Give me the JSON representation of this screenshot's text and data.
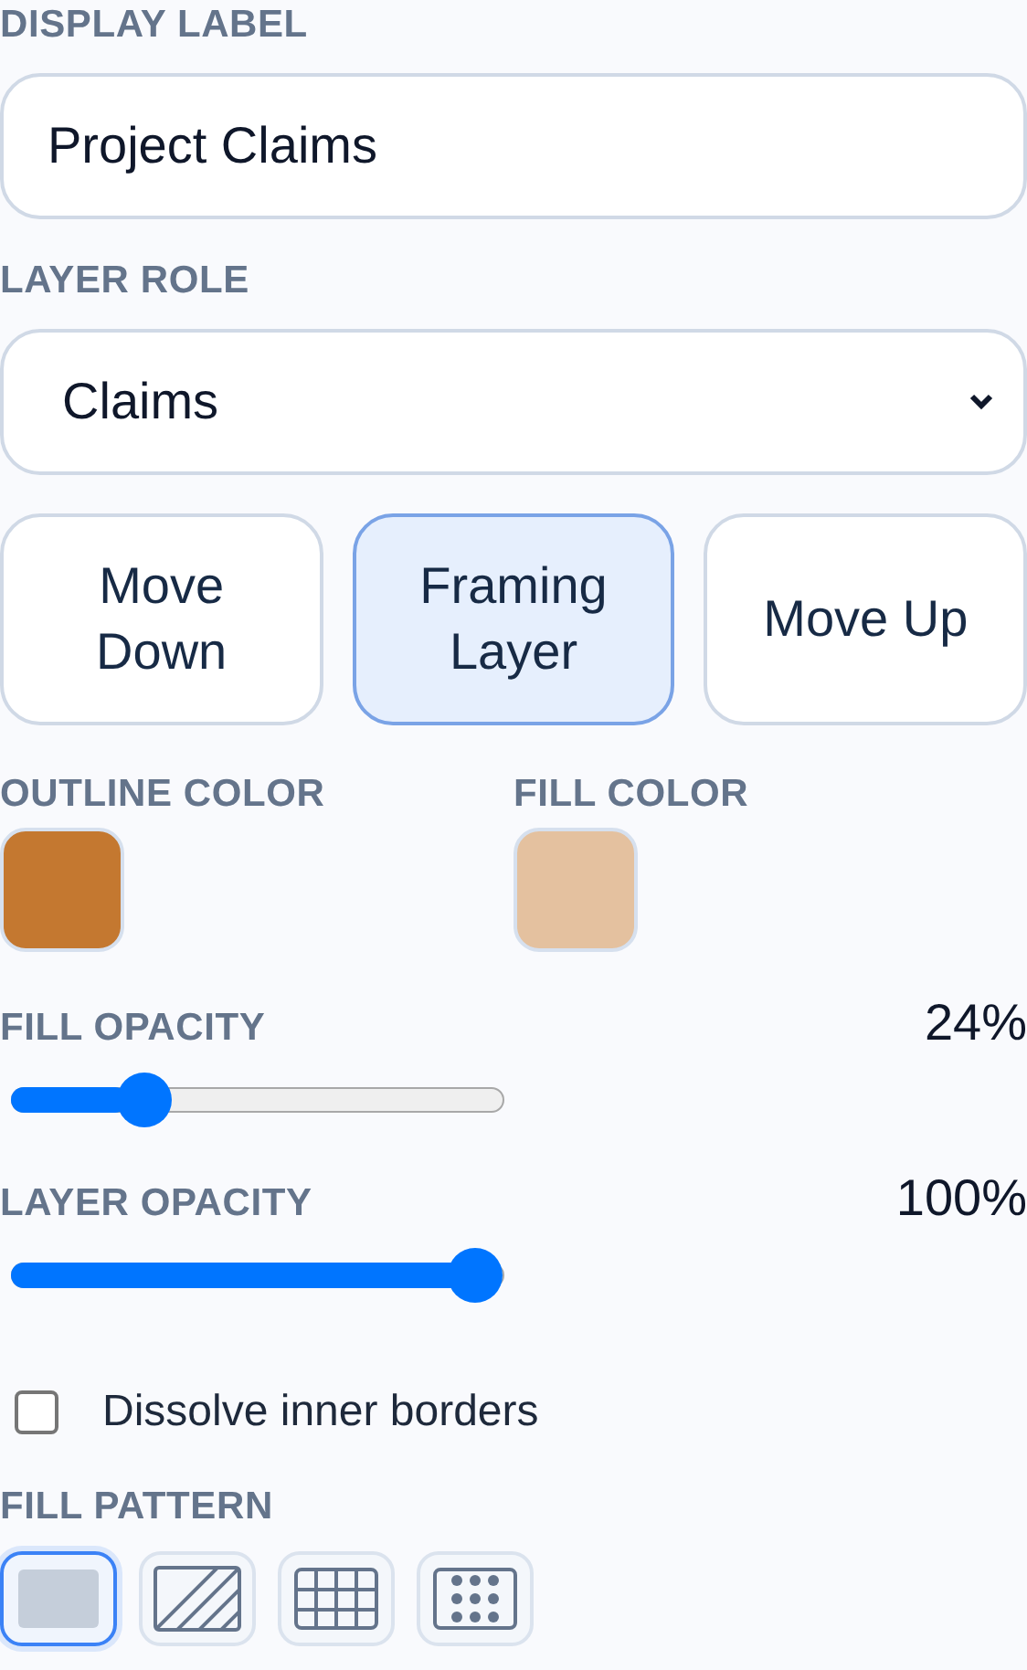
{
  "display_label": {
    "label": "DISPLAY LABEL",
    "value": "Project Claims"
  },
  "layer_role": {
    "label": "LAYER ROLE",
    "value": "Claims"
  },
  "order_buttons": [
    {
      "label": "Move Down",
      "selected": false
    },
    {
      "label": "Framing Layer",
      "selected": true
    },
    {
      "label": "Move Up",
      "selected": false
    }
  ],
  "colors": [
    {
      "label": "OUTLINE COLOR",
      "color": "#c47830"
    },
    {
      "label": "FILL COLOR",
      "color": "#e4c19f"
    }
  ],
  "sliders": [
    {
      "label": "FILL OPACITY",
      "reading": "24%",
      "level": 0.24
    },
    {
      "label": "LAYER OPACITY",
      "reading": "100%",
      "level": 1
    }
  ],
  "dissolve": {
    "label": "Dissolve inner borders",
    "checked": false
  },
  "fill_pattern": {
    "label": "FILL PATTERN",
    "options": [
      {
        "kind": "solid",
        "selected": true
      },
      {
        "kind": "hatch",
        "selected": false
      },
      {
        "kind": "grid",
        "selected": false
      },
      {
        "kind": "dots",
        "selected": false
      }
    ]
  }
}
